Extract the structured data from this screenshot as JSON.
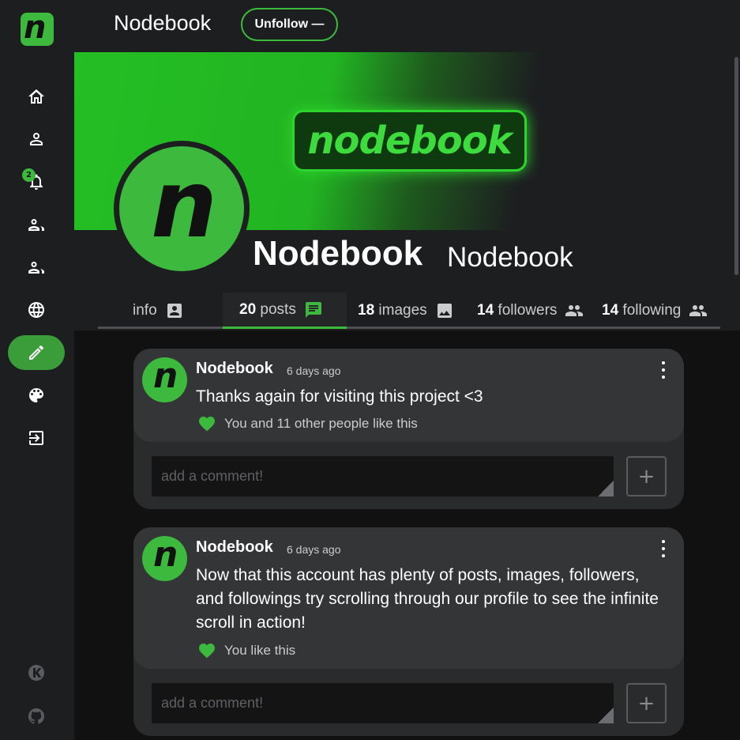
{
  "app": {
    "logo_letter": "n"
  },
  "sidebar": {
    "items": [
      {
        "icon": "home-icon"
      },
      {
        "icon": "profile-icon"
      },
      {
        "icon": "bell-icon",
        "badge": "2"
      },
      {
        "icon": "friends-icon"
      },
      {
        "icon": "groups-icon"
      },
      {
        "icon": "globe-icon"
      },
      {
        "icon": "pencil-icon",
        "active": true
      },
      {
        "icon": "palette-icon"
      },
      {
        "icon": "logout-icon"
      }
    ],
    "footer": [
      {
        "icon": "k-logo-icon"
      },
      {
        "icon": "github-icon"
      }
    ]
  },
  "header": {
    "title": "Nodebook",
    "unfollow_label": "Unfollow —"
  },
  "banner": {
    "logo_text": "nodebook"
  },
  "profile": {
    "avatar_letter": "n",
    "display_name": "Nodebook",
    "handle": "Nodebook"
  },
  "tabs": [
    {
      "count": "",
      "label": "info",
      "icon": "contact-card-icon"
    },
    {
      "count": "20",
      "label": "posts",
      "icon": "chat-icon",
      "active": true
    },
    {
      "count": "18",
      "label": "images",
      "icon": "image-icon"
    },
    {
      "count": "14",
      "label": "followers",
      "icon": "people-icon"
    },
    {
      "count": "14",
      "label": "following",
      "icon": "people-icon"
    }
  ],
  "posts": [
    {
      "author": "Nodebook",
      "time": "6 days ago",
      "avatar_letter": "n",
      "text": "Thanks again for visiting this project <3",
      "likes": "You and 11 other people like this",
      "comment_placeholder": "add a comment!",
      "add_label": "+"
    },
    {
      "author": "Nodebook",
      "time": "6 days ago",
      "avatar_letter": "n",
      "text": "Now that this account has plenty of posts, images, followers, and followings try scrolling through our profile to see the infinite scroll in action!",
      "likes": "You like this",
      "comment_placeholder": "add a comment!",
      "add_label": "+"
    }
  ],
  "colors": {
    "accent": "#3dba3d",
    "background": "#111112",
    "panel": "#1d1e20"
  }
}
